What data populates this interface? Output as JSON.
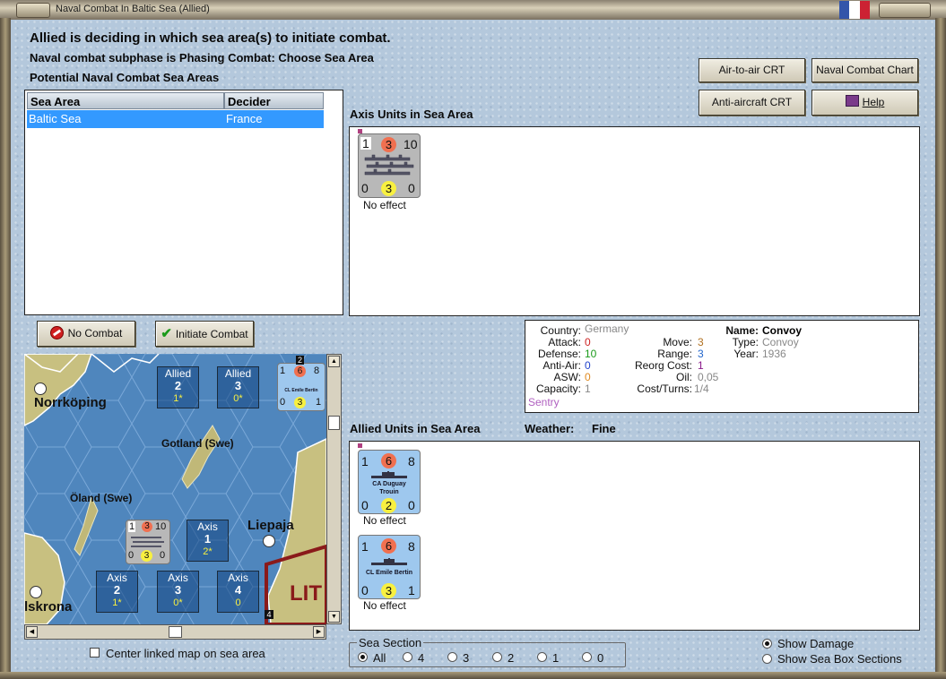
{
  "window": {
    "title": "Naval Combat In Baltic Sea (Allied)"
  },
  "colors": {
    "flag": [
      "#3355aa",
      "#ffffff",
      "#cc2233"
    ],
    "selection": "#3399ff"
  },
  "header": {
    "line1": "Allied is deciding in which sea area(s) to initiate combat.",
    "line2": "Naval combat subphase is Phasing Combat: Choose Sea Area",
    "line3": "Potential Naval Combat Sea Areas"
  },
  "table": {
    "columns": [
      "Sea Area",
      "Decider"
    ],
    "rows": [
      [
        "Baltic Sea",
        "France"
      ]
    ]
  },
  "buttons": {
    "air_to_air": "Air-to-air CRT",
    "naval_chart": "Naval Combat Chart",
    "anti_aircraft": "Anti-aircraft CRT",
    "help": "Help",
    "no_combat": "No Combat",
    "initiate": "Initiate Combat"
  },
  "axis_units": {
    "label": "Axis Units in Sea Area",
    "units": [
      {
        "top_left": "1",
        "top_mid": "3",
        "top_right": "10",
        "bot_left": "0",
        "bot_mid": "3",
        "bot_right": "0",
        "effect": "No effect"
      }
    ]
  },
  "info": {
    "country_k": "Country:",
    "country_v": "Germany",
    "attack_k": "Attack:",
    "attack_v": "0",
    "defense_k": "Defense:",
    "defense_v": "10",
    "antiair_k": "Anti-Air:",
    "antiair_v": "0",
    "asw_k": "ASW:",
    "asw_v": "0",
    "capacity_k": "Capacity:",
    "capacity_v": "1",
    "move_k": "Move:",
    "move_v": "3",
    "range_k": "Range:",
    "range_v": "3",
    "reorg_k": "Reorg Cost:",
    "reorg_v": "1",
    "oil_k": "Oil:",
    "oil_v": "0,05",
    "cost_k": "Cost/Turns:",
    "cost_v": "1/4",
    "name_k": "Name:",
    "name_v": "Convoy",
    "type_k": "Type:",
    "type_v": "Convoy",
    "year_k": "Year:",
    "year_v": "1936",
    "status": "Sentry"
  },
  "allied_units": {
    "label": "Allied Units in Sea Area",
    "weather_k": "Weather:",
    "weather_v": "Fine",
    "units": [
      {
        "top_left": "1",
        "top_mid": "6",
        "top_right": "8",
        "name1": "CA Duguay",
        "name2": "Trouin",
        "bot_left": "0",
        "bot_mid": "2",
        "bot_right": "0",
        "effect": "No effect"
      },
      {
        "top_left": "1",
        "top_mid": "6",
        "top_right": "8",
        "name1": "CL Emile Bertin",
        "name2": "",
        "bot_left": "0",
        "bot_mid": "3",
        "bot_right": "1",
        "effect": "No effect"
      }
    ]
  },
  "map": {
    "places": [
      "Norrköping",
      "Gotland (Swe)",
      "Öland (Swe)",
      "Liepaja",
      "lskrona",
      "LIT"
    ],
    "boxes": [
      {
        "side": "Allied",
        "num": "2",
        "sub": "1*"
      },
      {
        "side": "Allied",
        "num": "3",
        "sub": "0*"
      },
      {
        "side": "Axis",
        "num": "1",
        "sub": "2*"
      },
      {
        "side": "Axis",
        "num": "2",
        "sub": "1*"
      },
      {
        "side": "Axis",
        "num": "3",
        "sub": "0*"
      },
      {
        "side": "Axis",
        "num": "4",
        "sub": "0"
      }
    ],
    "corner_badges": [
      "2",
      "4"
    ],
    "map_unit_allied": {
      "tl": "1",
      "tm": "6",
      "tr": "8",
      "name": "CL Emile Bertin",
      "bl": "0",
      "bm": "3",
      "br": "1"
    },
    "map_unit_axis": {
      "tl": "1",
      "tm": "3",
      "tr": "10",
      "bl": "0",
      "bm": "3",
      "br": "0"
    }
  },
  "center_linked": "Center linked map on sea area",
  "sea_section": {
    "label": "Sea Section",
    "options": [
      "All",
      "4",
      "3",
      "2",
      "1",
      "0"
    ],
    "selected": "All"
  },
  "display_mode": {
    "options": [
      "Show Damage",
      "Show Sea Box Sections"
    ],
    "selected": "Show Damage"
  }
}
